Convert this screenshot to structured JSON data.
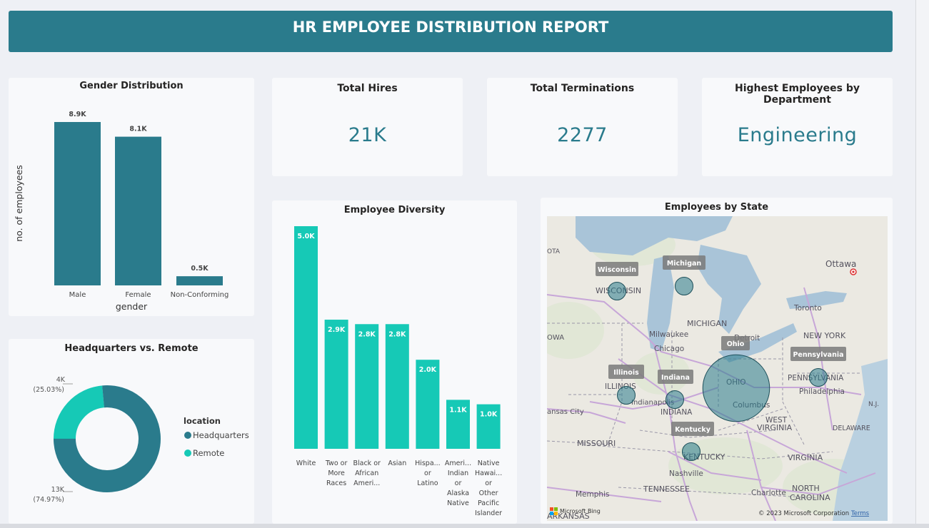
{
  "header": {
    "title": "HR EMPLOYEE DISTRIBUTION REPORT"
  },
  "colors": {
    "teal_dark": "#2a7b8c",
    "teal_light": "#16c9b6",
    "card_bg": "#f8f9fb",
    "page_bg": "#eef0f5"
  },
  "kpis": [
    {
      "title": "Total Hires",
      "value": "21K"
    },
    {
      "title": "Total Terminations",
      "value": "2277"
    },
    {
      "title": "Highest Employees by Department",
      "value": "Engineering"
    }
  ],
  "chart_data": [
    {
      "type": "bar",
      "title": "Gender Distribution",
      "xlabel": "gender",
      "ylabel": "no. of employees",
      "categories": [
        "Male",
        "Female",
        "Non-Conforming"
      ],
      "values": [
        8900,
        8100,
        500
      ],
      "data_labels": [
        "8.9K",
        "8.1K",
        "0.5K"
      ],
      "ylim": [
        0,
        8900
      ],
      "color": "#2a7b8c"
    },
    {
      "type": "pie",
      "title": "Headquarters vs. Remote",
      "legend_title": "location",
      "legend_position": "right",
      "slices": [
        {
          "name": "Headquarters",
          "value": 13000,
          "percent": 74.97,
          "label": "13K",
          "pct_label": "(74.97%)",
          "color": "#2a7b8c"
        },
        {
          "name": "Remote",
          "value": 4000,
          "percent": 25.03,
          "label": "4K",
          "pct_label": "(25.03%)",
          "color": "#16c9b6"
        }
      ]
    },
    {
      "type": "bar",
      "title": "Employee Diversity",
      "categories": [
        [
          "White"
        ],
        [
          "Two or",
          "More",
          "Races"
        ],
        [
          "Black or",
          "African",
          "Ameri..."
        ],
        [
          "Asian"
        ],
        [
          "Hispa...",
          "or",
          "Latino"
        ],
        [
          "Ameri...",
          "Indian",
          "or",
          "Alaska",
          "Native"
        ],
        [
          "Native",
          "Hawai...",
          "or",
          "Other",
          "Pacific",
          "Islander"
        ]
      ],
      "values": [
        5000,
        2900,
        2800,
        2800,
        2000,
        1100,
        1000
      ],
      "data_labels": [
        "5.0K",
        "2.9K",
        "2.8K",
        "2.8K",
        "2.0K",
        "1.1K",
        "1.0K"
      ],
      "ylim": [
        0,
        5000
      ],
      "color": "#16c9b6"
    }
  ],
  "map": {
    "title": "Employees by State",
    "states": [
      {
        "name": "Wisconsin",
        "value": 1
      },
      {
        "name": "Michigan",
        "value": 1
      },
      {
        "name": "Ohio",
        "value": 14
      },
      {
        "name": "Pennsylvania",
        "value": 1
      },
      {
        "name": "Illinois",
        "value": 1
      },
      {
        "name": "Indiana",
        "value": 1
      },
      {
        "name": "Kentucky",
        "value": 1
      }
    ],
    "base_labels": [
      "OTA",
      "WISCONSIN",
      "MICHIGAN",
      "Ottawa",
      "Toronto",
      "Milwaukee",
      "Chicago",
      "Detroit",
      "NEW YORK",
      "OWA",
      "ILLINOIS",
      "PENNSYLVANIA",
      "Philadelphia",
      "OHIO",
      "Columbus",
      "Indianapolis",
      "INDIANA",
      "ansas City",
      "WEST",
      "VIRGINIA",
      "DELAWARE",
      "MISSOURI",
      "KENTUCKY",
      "VIRGINIA",
      "Nashville",
      "TENNESSEE",
      "Charlotte",
      "NORTH",
      "CAROLINA",
      "Memphis",
      "ARKANSAS",
      "N.J."
    ],
    "attribution": "© 2023 Microsoft Corporation",
    "terms": "Terms",
    "bing": "Microsoft Bing"
  }
}
